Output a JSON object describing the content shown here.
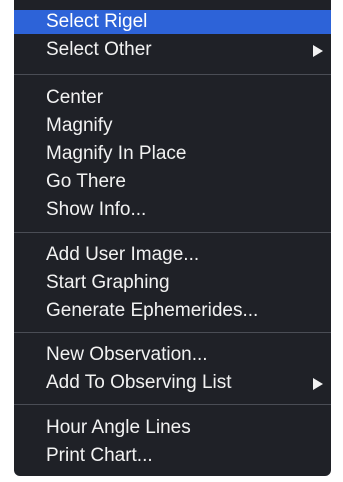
{
  "context_menu": {
    "groups": [
      {
        "items": [
          {
            "label": "Select Rigel",
            "selected": true
          },
          {
            "label": "Select Other",
            "submenu": true
          }
        ]
      },
      {
        "items": [
          {
            "label": "Center"
          },
          {
            "label": "Magnify"
          },
          {
            "label": "Magnify In Place"
          },
          {
            "label": "Go There"
          },
          {
            "label": "Show Info..."
          }
        ]
      },
      {
        "items": [
          {
            "label": "Add User Image..."
          },
          {
            "label": "Start Graphing"
          },
          {
            "label": "Generate Ephemerides..."
          }
        ]
      },
      {
        "items": [
          {
            "label": "New Observation..."
          },
          {
            "label": "Add To Observing List",
            "submenu": true
          }
        ]
      },
      {
        "items": [
          {
            "label": "Hour Angle Lines"
          },
          {
            "label": "Print Chart..."
          }
        ]
      }
    ],
    "colors": {
      "background": "#1f2127",
      "highlight": "#2d63d8",
      "separator": "#4a4d55",
      "text": "#f2f2f2"
    },
    "icons": {
      "submenu_arrow": "triangle-right-icon"
    }
  }
}
